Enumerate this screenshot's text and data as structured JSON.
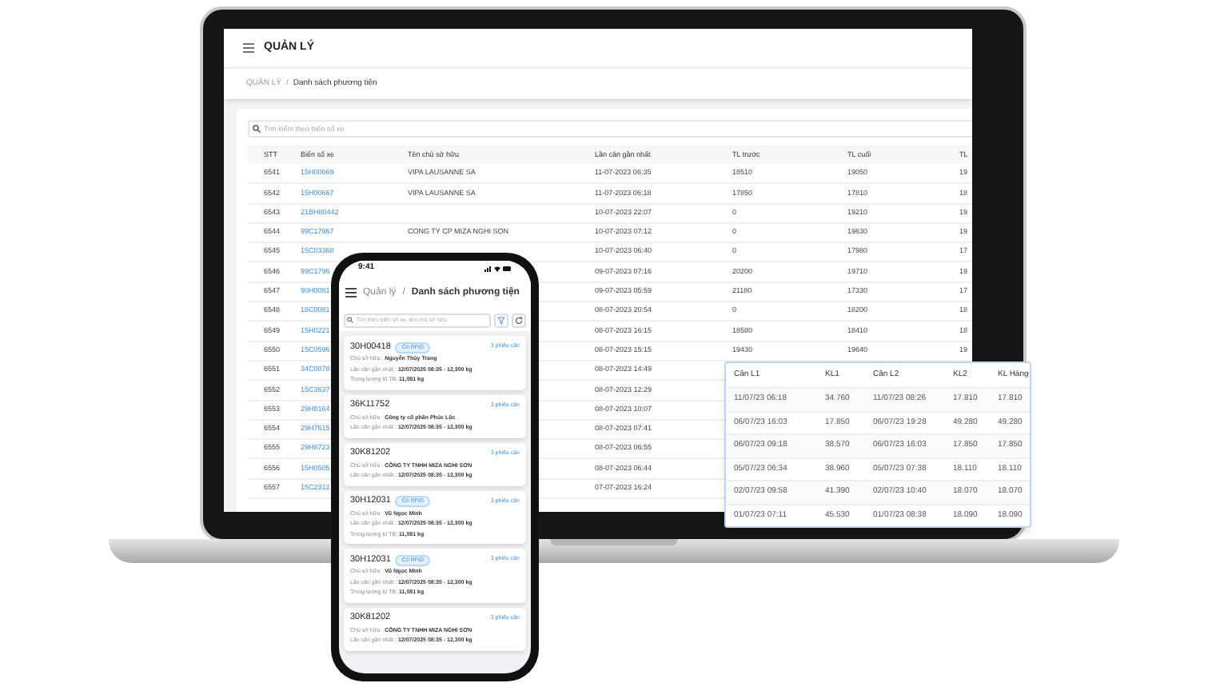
{
  "laptop": {
    "app_title": "QUẢN LÝ",
    "breadcrumb": [
      "QUẢN LÝ",
      "/",
      "Danh sách phương tiện"
    ],
    "search": {
      "placeholder": "Tìm kiếm theo biển số xe"
    },
    "table": {
      "columns": [
        "STT",
        "Biển số xe",
        "Tên chủ sở hữu",
        "Lần cân gần nhất",
        "TL trước",
        "TL cuối",
        "TL"
      ],
      "rows": [
        [
          "6541",
          "15H00669",
          "VIPA LAUSANNE SA",
          "11-07-2023 06:35",
          "18510",
          "19050",
          "19"
        ],
        [
          "6542",
          "15H00667",
          "VIPA LAUSANNE SA",
          "11-07-2023 06:18",
          "17850",
          "17810",
          "18"
        ],
        [
          "6543",
          "21BH80442",
          null,
          "10-07-2023 22:07",
          "0",
          "19210",
          "19"
        ],
        [
          "6544",
          "99C17967",
          "CONG TY CP MIZA NGHI SON",
          "10-07-2023 07:12",
          "0",
          "19630",
          "19"
        ],
        [
          "6545",
          "15C03368",
          null,
          "10-07-2023 06:40",
          "0",
          "17980",
          "17"
        ],
        [
          "6546",
          "99C1796",
          null,
          "09-07-2023 07:16",
          "20200",
          "19710",
          "19"
        ],
        [
          "6547",
          "90H0081",
          null,
          "09-07-2023 05:59",
          "21180",
          "17330",
          "17"
        ],
        [
          "6548",
          "18C0081",
          null,
          "08-07-2023 20:54",
          "0",
          "18200",
          "18"
        ],
        [
          "6549",
          "15H0221",
          null,
          "08-07-2023 16:15",
          "18580",
          "18410",
          "18"
        ],
        [
          "6550",
          "15C0596",
          null,
          "08-07-2023 15:15",
          "19430",
          "19640",
          "19"
        ],
        [
          "6551",
          "34C0878",
          null,
          "08-07-2023 14:49",
          null,
          null,
          null
        ],
        [
          "6552",
          "15C3637",
          null,
          "08-07-2023 12:29",
          null,
          null,
          null
        ],
        [
          "6553",
          "29H8164",
          null,
          "08-07-2023 10:07",
          null,
          null,
          null
        ],
        [
          "6554",
          "29H7615",
          null,
          "08-07-2023 07:41",
          null,
          null,
          null
        ],
        [
          "6555",
          "29H8723",
          null,
          "08-07-2023 06:55",
          null,
          null,
          null
        ],
        [
          "6556",
          "15H0505",
          null,
          "08-07-2023 06:44",
          null,
          null,
          null
        ],
        [
          "6557",
          "15C2312",
          null,
          "07-07-2023 16:24",
          null,
          null,
          null
        ]
      ]
    }
  },
  "weighing_popup": {
    "columns": [
      "Cân L1",
      "KL1",
      "Cân L2",
      "KL2",
      "KL Hàng"
    ],
    "rows": [
      [
        "11/07/23 06:18",
        "34.760",
        "11/07/23 08:26",
        "17.810",
        "17.810"
      ],
      [
        "06/07/23 16:03",
        "17.850",
        "06/07/23 19:28",
        "49.280",
        "49.280"
      ],
      [
        "06/07/23 09:18",
        "38.570",
        "06/07/23 16:03",
        "17.850",
        "17.850"
      ],
      [
        "05/07/23 06:34",
        "38.960",
        "05/07/23 07:38",
        "18.110",
        "18.110"
      ],
      [
        "02/07/23 09:58",
        "41.390",
        "02/07/23 10:40",
        "18.070",
        "18.070"
      ],
      [
        "01/07/23 07:11",
        "45.530",
        "01/07/23 08:38",
        "18.090",
        "18.090"
      ]
    ]
  },
  "phone": {
    "time": "9:41",
    "breadcrumb": [
      "Quản lý",
      "/",
      "Danh sách phương tiện"
    ],
    "search": {
      "placeholder": "Tìm theo biển số xe, tên chủ sở hữu"
    },
    "cards": [
      {
        "plate": "30H00418",
        "badge": "Có RFID",
        "link": "3 phiếu cân",
        "lines": [
          "Chủ sở hữu : **Nguyễn Thùy Trang**",
          "Lần cân gần nhất : **12/07/2025 08:35 - 12,300 kg**",
          "Trọng lượng bì TB: **11,081 kg**"
        ]
      },
      {
        "plate": "36K11752",
        "link": "3 phiếu cân",
        "lines": [
          "Chủ sở hữu : **Công ty cổ phần Phúc Lộc**",
          "Lần cân gần nhất : **12/07/2025 08:35 - 12,300 kg**"
        ]
      },
      {
        "plate": "30K81202",
        "link": "3 phiếu cân",
        "lines": [
          "Chủ sở hữu : **CÔNG TY TNHH MIZA NGHI SƠN**",
          "Lần cân gần nhất : **12/07/2025 08:35 - 12,300 kg**"
        ]
      },
      {
        "plate": "30H12031",
        "badge": "Có RFID",
        "link": "3 phiếu cân",
        "lines": [
          "Chủ sở hữu : **Vũ Ngọc Minh**",
          "Lần cân gần nhất : **12/07/2025 08:35 - 12,300 kg**",
          "Trọng lượng bì TB: **11,081 kg**"
        ]
      },
      {
        "plate": "30H12031",
        "badge": "Có RFID",
        "link": "3 phiếu cân",
        "lines": [
          "Chủ sở hữu : **Vũ Ngọc Minh**",
          "Lần cân gần nhất : **12/07/2025 08:35 - 12,300 kg**",
          "Trọng lượng bì TB: **11,081 kg**"
        ]
      },
      {
        "plate": "30K81202",
        "link": "3 phiếu cân",
        "lines": [
          "Chủ sở hữu : **CÔNG TY TNHH MIZA NGHI SƠN**",
          "Lần cân gần nhất : **12/07/2025 08:35 - 12,300 kg**"
        ]
      }
    ]
  }
}
